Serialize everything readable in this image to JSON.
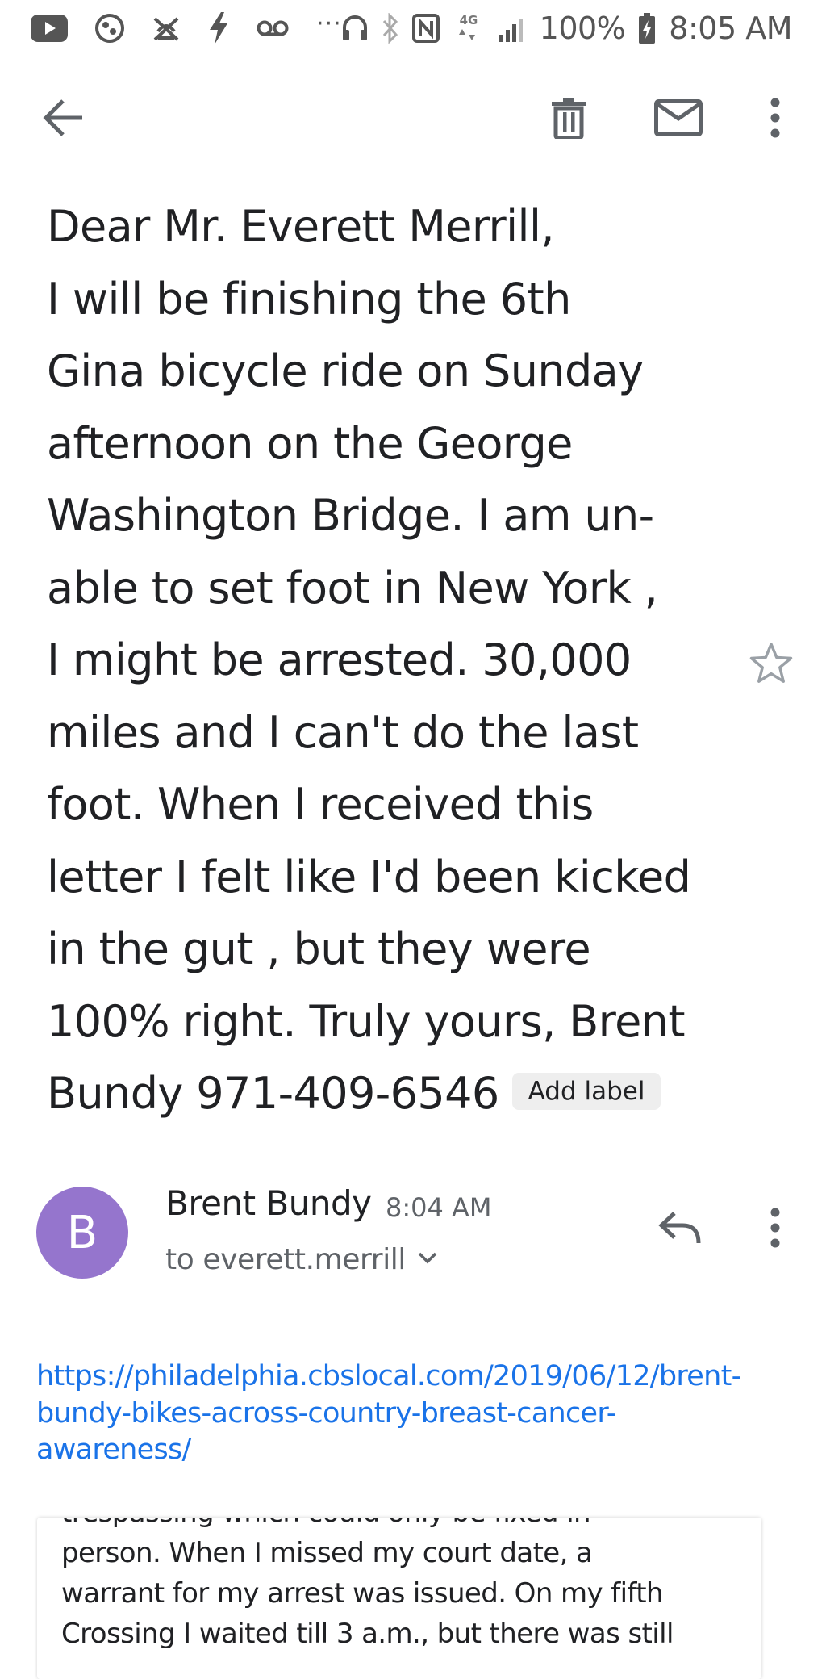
{
  "status_bar": {
    "icons": [
      "youtube-icon",
      "sports-icon",
      "alarm-off-icon",
      "flash-icon",
      "voicemail-icon",
      "more-notifications-icon",
      "headset-icon",
      "bluetooth-icon",
      "nfc-icon",
      "network-4g-icon",
      "signal-icon",
      "battery-icon"
    ],
    "more_indicator": "···",
    "network_label": "4G",
    "battery_percent": "100%",
    "time": "8:05 AM"
  },
  "toolbar": {
    "icons": [
      "back-arrow-icon",
      "delete-icon",
      "mark-unread-icon",
      "more-vert-icon"
    ]
  },
  "message": {
    "body_lines": [
      "Dear Mr. Everett Merrill,",
      "I will be finishing the 6th",
      "Gina bicycle ride on Sunday",
      "afternoon on the George",
      "Washington Bridge. I am un-",
      "able to set foot in New York ,",
      "I might be arrested. 30,000",
      "miles and I can't do the last",
      "foot. When I received this",
      "letter I felt like I'd been kicked",
      "in the gut , but they were",
      "100% right. Truly yours, Brent",
      "Bundy 971-409-6546"
    ],
    "add_label": "Add label",
    "star_icon": "star-outline-icon"
  },
  "sender": {
    "avatar_letter": "B",
    "avatar_color": "#9575cd",
    "name": "Brent Bundy",
    "time": "8:04 AM",
    "recipient": "to everett.merrill",
    "icons": [
      "chevron-down-icon",
      "reply-icon",
      "more-vert-icon"
    ]
  },
  "link": {
    "lines": [
      "https://philadelphia.cbslocal.com/2019/06/12/brent-",
      "bundy-bikes-across-country-breast-cancer-",
      "awareness/"
    ],
    "color": "#1a73e8"
  },
  "quoted_preview": {
    "lines": [
      "trespassing which could only be fixed in",
      "person. When I missed my court date, a",
      "warrant for my arrest was issued. On my fifth",
      "Crossing I waited till 3 a.m., but there was still"
    ]
  }
}
